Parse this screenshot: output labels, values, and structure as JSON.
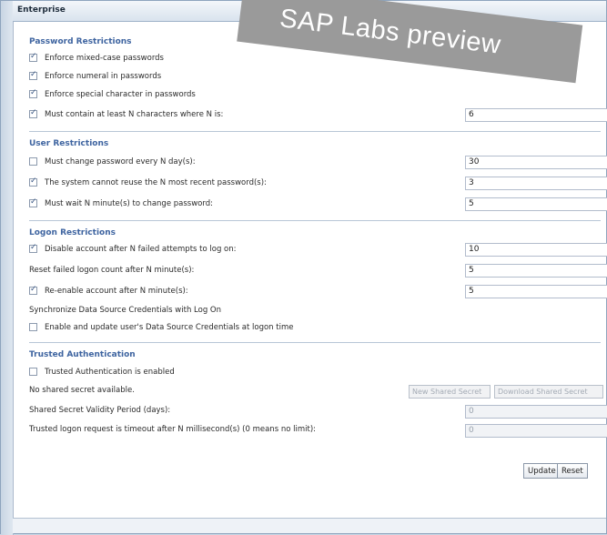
{
  "window": {
    "title": "Enterprise"
  },
  "watermark": "SAP Labs preview",
  "password": {
    "title": "Password Restrictions",
    "items": [
      {
        "label": "Enforce mixed-case passwords",
        "checked": true
      },
      {
        "label": "Enforce numeral in passwords",
        "checked": true
      },
      {
        "label": "Enforce special character in passwords",
        "checked": true
      },
      {
        "label": "Must contain at least N characters where N is:",
        "checked": true,
        "value": "6"
      }
    ]
  },
  "user": {
    "title": "User Restrictions",
    "items": [
      {
        "label": "Must change password every N day(s):",
        "checked": false,
        "value": "30"
      },
      {
        "label": "The system cannot reuse the N most recent password(s):",
        "checked": true,
        "value": "3"
      },
      {
        "label": "Must wait N minute(s) to change password:",
        "checked": true,
        "value": "5"
      }
    ]
  },
  "logon": {
    "title": "Logon Restrictions",
    "disable_label": "Disable account after N failed attempts to log on:",
    "disable_checked": true,
    "disable_value": "10",
    "reset_label": "Reset failed logon count after N minute(s):",
    "reset_value": "5",
    "reenable_label": "Re-enable account after N minute(s):",
    "reenable_checked": true,
    "reenable_value": "5",
    "sync_label": "Synchronize Data Source Credentials with Log On",
    "update_label": "Enable and update user's Data Source Credentials at logon time",
    "update_checked": false
  },
  "trusted": {
    "title": "Trusted Authentication",
    "enabled_label": "Trusted Authentication is enabled",
    "enabled_checked": false,
    "no_secret_text": "No shared secret available.",
    "new_secret_button": "New Shared Secret",
    "download_secret_button": "Download Shared Secret",
    "validity_label": "Shared Secret Validity Period (days):",
    "validity_value": "0",
    "timeout_label": "Trusted logon request is timeout after N millisecond(s) (0 means no limit):",
    "timeout_value": "0"
  },
  "actions": {
    "update": "Update",
    "reset": "Reset"
  }
}
